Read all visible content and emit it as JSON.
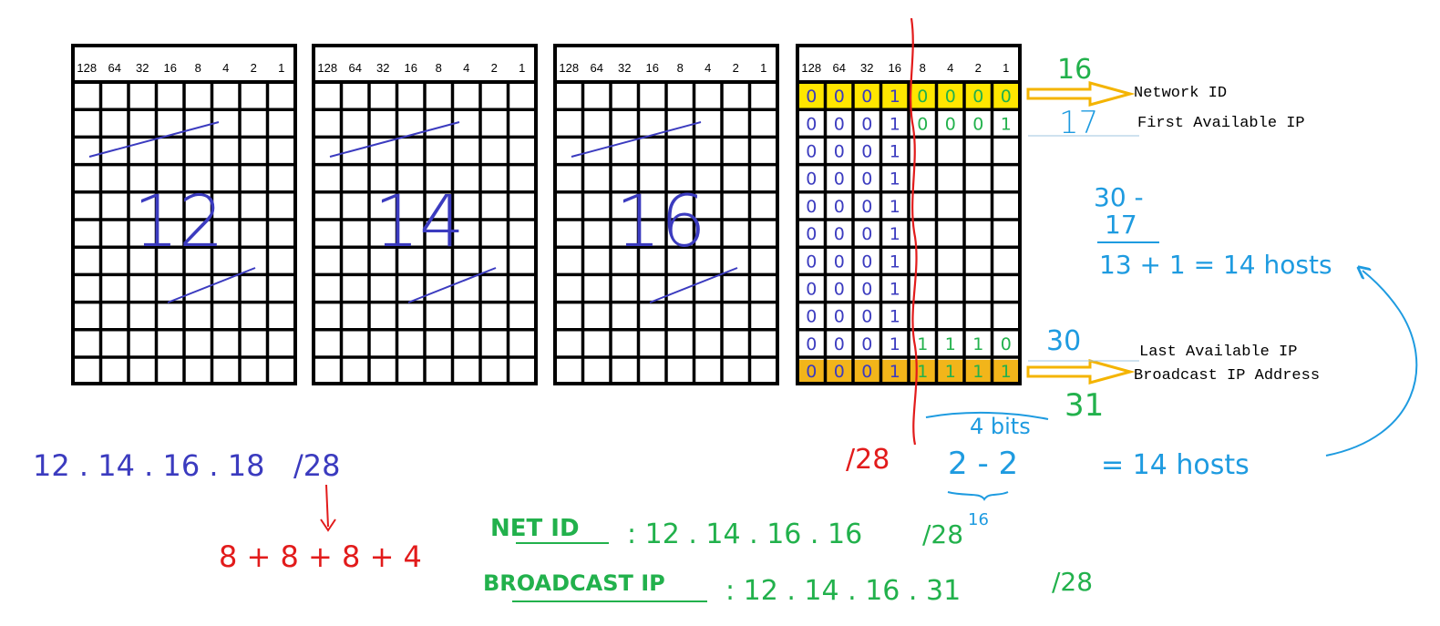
{
  "bit_headers": [
    "128",
    "64",
    "32",
    "16",
    "8",
    "4",
    "2",
    "1"
  ],
  "grids": [
    {
      "id": "octet-1",
      "value": "12"
    },
    {
      "id": "octet-2",
      "value": "14"
    },
    {
      "id": "octet-3",
      "value": "16"
    },
    {
      "id": "octet-4",
      "value": ""
    }
  ],
  "fourth_octet": {
    "network_row": [
      "0",
      "0",
      "0",
      "1",
      "0",
      "0",
      "0",
      "0"
    ],
    "first_row": [
      "0",
      "0",
      "0",
      "1",
      "0",
      "0",
      "0",
      "1"
    ],
    "middle_rows": [
      "0",
      "0",
      "0",
      "1"
    ],
    "last_row": [
      "0",
      "0",
      "0",
      "1",
      "1",
      "1",
      "1",
      "0"
    ],
    "broadcast_row": [
      "0",
      "0",
      "0",
      "1",
      "1",
      "1",
      "1",
      "1"
    ]
  },
  "row_labels": {
    "network_id": "Network ID",
    "first_ip": "First Available IP",
    "last_ip": "Last Available IP",
    "broadcast": "Broadcast IP Address"
  },
  "annotations": {
    "num_16": "16",
    "num_17": "17",
    "num_30": "30",
    "num_31": "31",
    "calc_30": "30 -",
    "calc_17": "17",
    "calc_result": "13 + 1  =  14 hosts",
    "bits": "4 bits",
    "prefix_red": "/28",
    "power_base": "2  -  2",
    "power_exp": "4",
    "hosts": "=  14 hosts",
    "address": "12 . 14 . 16 . 18",
    "address_prefix": "/28",
    "sum": "8 + 8 + 8 + 4",
    "net_id_label": "NET ID",
    "net_id_value": ":  12 . 14 . 16 . 16",
    "net_id_prefix": "/28",
    "net_id_sup": "16",
    "broadcast_label": "BROADCAST IP",
    "broadcast_value": ":  12 . 14 . 16 . 31",
    "broadcast_prefix": "/28"
  },
  "colors": {
    "grid": "#000000",
    "highlight_network": "#ffe600",
    "highlight_broadcast": "#f2b51a",
    "arrow": "#f4b400",
    "blue_ink": "#3b3bbf",
    "green_ink": "#22b14c",
    "red_ink": "#e21b1b",
    "cyan_ink": "#1e9be0"
  }
}
